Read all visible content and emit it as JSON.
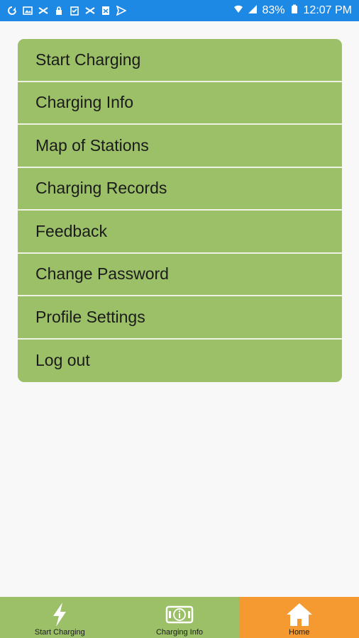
{
  "status_bar": {
    "battery": "83%",
    "time": "12:07 PM",
    "left_icons": [
      "sync-icon",
      "image-icon",
      "shuffle-icon",
      "lock-icon",
      "clipboard-icon",
      "shuffle-icon",
      "file-icon",
      "send-icon"
    ]
  },
  "menu": {
    "items": [
      {
        "label": "Start Charging"
      },
      {
        "label": "Charging Info"
      },
      {
        "label": "Map of Stations"
      },
      {
        "label": "Charging Records"
      },
      {
        "label": "Feedback"
      },
      {
        "label": "Change Password"
      },
      {
        "label": "Profile Settings"
      },
      {
        "label": "Log out"
      }
    ]
  },
  "bottom_nav": {
    "tabs": [
      {
        "label": "Start Charging",
        "icon": "lightning-icon"
      },
      {
        "label": "Charging Info",
        "icon": "info-card-icon"
      },
      {
        "label": "Home",
        "icon": "home-icon",
        "active": true
      }
    ]
  },
  "colors": {
    "status_bar": "#1e88e5",
    "menu_item": "#9bc068",
    "active_tab": "#f59a30",
    "background": "#f8f8f8"
  }
}
